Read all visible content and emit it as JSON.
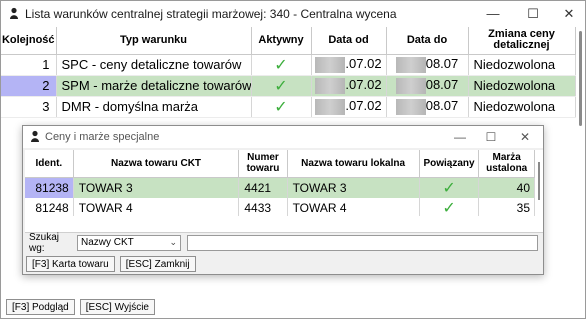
{
  "main": {
    "title": "Lista warunków centralnej strategii marżowej: 340 - Centralna wycena",
    "columns": [
      "Kolejność",
      "Typ warunku",
      "Aktywny",
      "Data od",
      "Data do",
      "Zmiana ceny detalicznej"
    ],
    "rows": [
      {
        "order": "1",
        "type": "SPC - ceny detaliczne towarów",
        "active": "✓",
        "date_from": ".07.02",
        "date_to": "08.07",
        "change": "Niedozwolona"
      },
      {
        "order": "2",
        "type": "SPM - marże detaliczne towarów",
        "active": "✓",
        "date_from": ".07.02",
        "date_to": "08.07",
        "change": "Niedozwolona"
      },
      {
        "order": "3",
        "type": "DMR - domyślna marża",
        "active": "✓",
        "date_from": ".07.02",
        "date_to": "08.07",
        "change": "Niedozwolona"
      }
    ],
    "buttons": {
      "preview": "[F3] Podgląd",
      "exit": "[ESC] Wyjście"
    }
  },
  "dialog": {
    "title": "Ceny i marże specjalne",
    "columns": [
      "Ident.",
      "Nazwa towaru CKT",
      "Numer towaru",
      "Nazwa towaru lokalna",
      "Powiązany",
      "Marża ustalona"
    ],
    "rows": [
      {
        "id": "81238",
        "name_ckt": "TOWAR 3",
        "number": "4421",
        "name_local": "TOWAR 3",
        "linked": "✓",
        "margin": "40"
      },
      {
        "id": "81248",
        "name_ckt": "TOWAR 4",
        "number": "4433",
        "name_local": "TOWAR 4",
        "linked": "✓",
        "margin": "35"
      }
    ],
    "search_label": "Szukaj wg:",
    "search_by": "Nazwy CKT",
    "buttons": {
      "card": "[F3] Karta towaru",
      "close": "[ESC] Zamknij"
    }
  },
  "colors": {
    "selected_row": "#c7e2c2",
    "selected_key": "#b4b4f5",
    "check": "#3cae3c"
  },
  "icons": {
    "app": "app-person-icon",
    "minimize": "minimize-icon",
    "maximize": "maximize-icon",
    "close": "close-icon"
  }
}
